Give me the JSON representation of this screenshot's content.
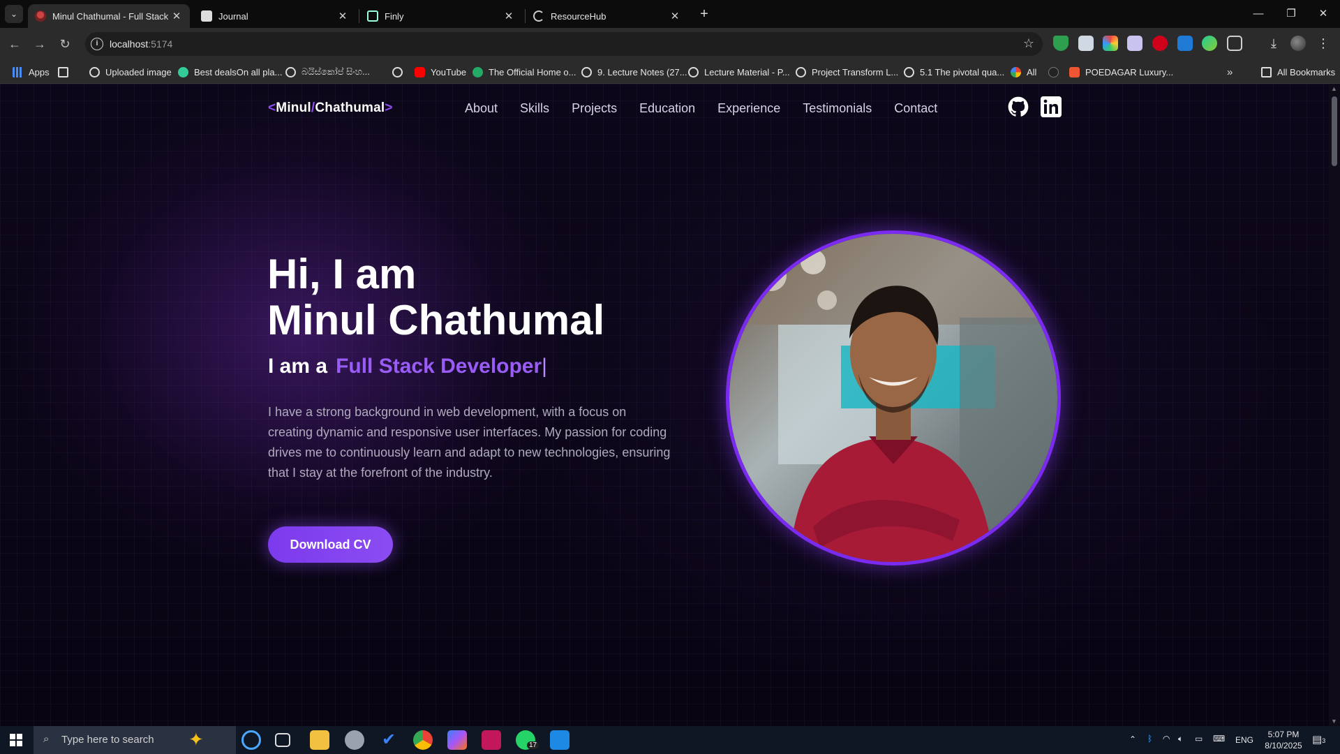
{
  "browser": {
    "tabs": [
      {
        "title": "Minul Chathumal - Full Stack De",
        "active": true
      },
      {
        "title": "Journal",
        "active": false
      },
      {
        "title": "Finly",
        "active": false
      },
      {
        "title": "ResourceHub",
        "active": false
      }
    ],
    "url_host": "localhost",
    "url_port": ":5174",
    "bookmarks": [
      "Apps",
      "Uploaded image",
      "Best dealsOn all pla...",
      "බයිස්කෝප් සිංහ...",
      "YouTube",
      "The Official Home o...",
      "9. Lecture Notes (27...",
      "Lecture Material - P...",
      "Project Transform L...",
      "5.1 The pivotal qua...",
      "All",
      "POEDAGAR Luxury..."
    ],
    "all_bookmarks": "All Bookmarks"
  },
  "site": {
    "brand_open": "<",
    "brand_first": "Minul",
    "brand_slash": "/",
    "brand_last": "Chathumal",
    "brand_close": ">",
    "nav": [
      "About",
      "Skills",
      "Projects",
      "Education",
      "Experience",
      "Testimonials",
      "Contact"
    ],
    "hero": {
      "greeting_line1": "Hi, I am",
      "greeting_line2": "Minul Chathumal",
      "role_prefix": "I am a",
      "role_typed": "Full Stack Developer",
      "caret": "|",
      "description": "I have a strong background in web development, with a focus on creating dynamic and responsive user interfaces. My passion for coding drives me to continuously learn and adapt to new technologies, ensuring that I stay at the forefront of the industry.",
      "cta": "Download CV"
    },
    "colors": {
      "accent": "#8b4cf2",
      "ring": "#7b2bf0",
      "background": "#0b0616"
    }
  },
  "taskbar": {
    "search_placeholder": "Type here to search",
    "whatsapp_badge": "17",
    "language": "ENG",
    "time": "5:07 PM",
    "date": "8/10/2025",
    "notifications": "3"
  }
}
